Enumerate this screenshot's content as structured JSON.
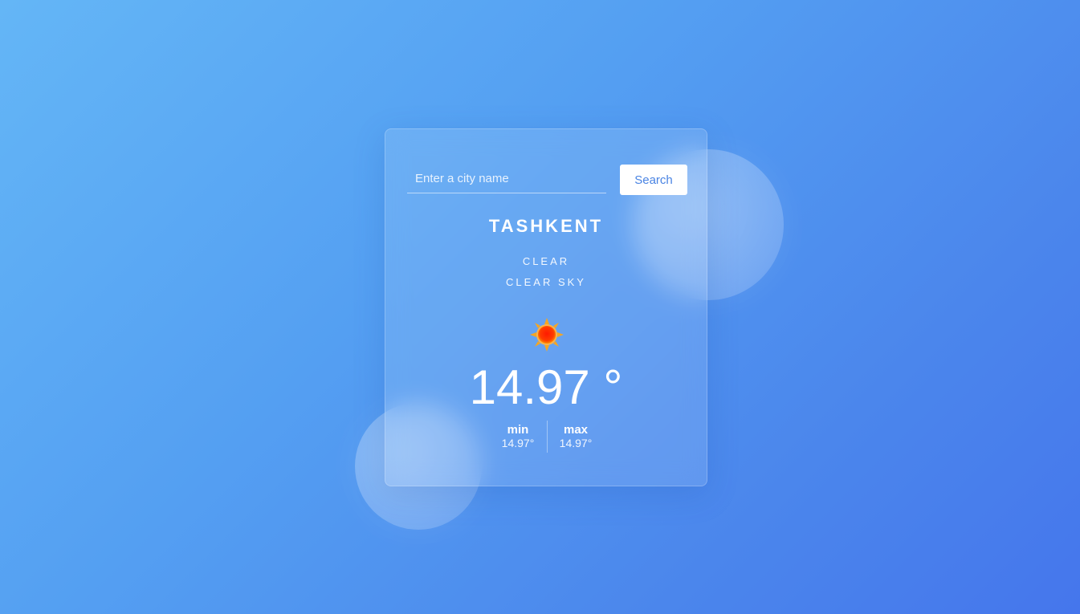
{
  "search": {
    "placeholder": "Enter a city name",
    "value": "",
    "button_label": "Search"
  },
  "weather": {
    "city": "TASHKENT",
    "condition": "CLEAR",
    "description": "CLEAR SKY",
    "icon": "sun-icon",
    "temperature": "14.97 °",
    "min_label": "min",
    "min_value": "14.97°",
    "max_label": "max",
    "max_value": "14.97°"
  },
  "colors": {
    "background_start": "#64b6f6",
    "background_end": "#4576ec",
    "button_text": "#4a84e3",
    "sun_core": "#ff2b00",
    "sun_rays": "#f5a623"
  }
}
